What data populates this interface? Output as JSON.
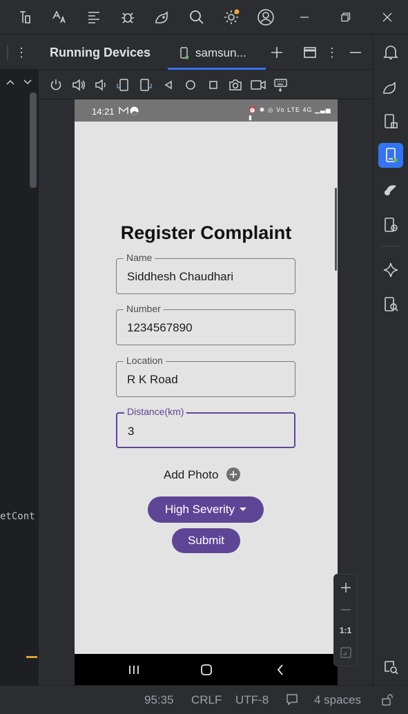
{
  "toolbar": {
    "icons": [
      "project-structure-icon",
      "translate-icon",
      "logcat-icon",
      "debug-icon",
      "device-manager-icon",
      "search-icon",
      "settings-icon",
      "account-icon"
    ]
  },
  "editor": {
    "code_fragment": "etCont"
  },
  "panel": {
    "title": "Running Devices",
    "device_tab_label": "samsun..."
  },
  "phone": {
    "status_time": "14:21",
    "status_right": "⏰ ✱ ◎ Vo LTE 4G ▁▃▅ ▮",
    "screen_title": "Register Complaint",
    "fields": {
      "name": {
        "label": "Name",
        "value": "Siddhesh Chaudhari"
      },
      "number": {
        "label": "Number",
        "value": "1234567890"
      },
      "location": {
        "label": "Location",
        "value": "R K Road"
      },
      "distance": {
        "label": "Distance(km)",
        "value": "3"
      }
    },
    "add_photo_label": "Add Photo",
    "severity_label": "High Severity",
    "submit_label": "Submit"
  },
  "zoom": {
    "ratio_label": "1:1"
  },
  "status": {
    "position": "95:35",
    "line_separator": "CRLF",
    "encoding": "UTF-8",
    "indent": "4 spaces"
  },
  "colors": {
    "accent": "#5e4596",
    "focus": "#5d4595",
    "ide_accent": "#3574f0"
  }
}
